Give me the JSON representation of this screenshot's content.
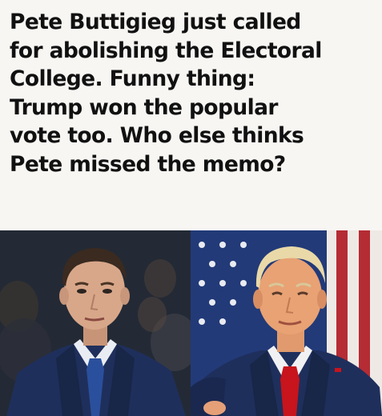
{
  "caption": {
    "lines": [
      "Pete Buttigieg just called",
      "for abolishing the Electoral",
      "College. Funny thing:",
      "Trump won the popular",
      "vote too. Who else thinks",
      "Pete missed the memo?"
    ]
  },
  "photos": {
    "left": {
      "subject": "Pete Buttigieg portrait"
    },
    "right": {
      "subject": "Donald Trump portrait",
      "backdrop": "american-flag"
    }
  },
  "colors": {
    "caption_bg": "#f7f6f3",
    "text": "#111111",
    "suit_navy": "#1f2f5c",
    "tie_red": "#c8141c",
    "tie_blue": "#2a4f9c",
    "flag_red": "#b52c34"
  }
}
